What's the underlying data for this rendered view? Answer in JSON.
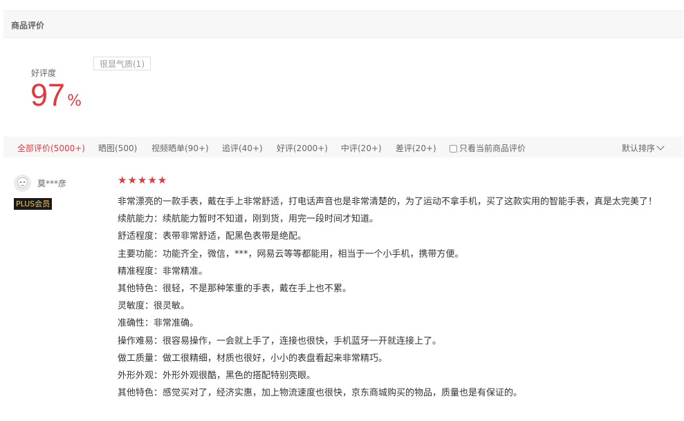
{
  "header": {
    "title": "商品评价"
  },
  "rating": {
    "label": "好评度",
    "value": "97",
    "unit": "%"
  },
  "tags": [
    {
      "label": "很显气质(1)"
    }
  ],
  "filters": [
    {
      "label": "全部评价(5000+)",
      "active": true
    },
    {
      "label": "晒图(500)"
    },
    {
      "label": "视频晒单(90+)"
    },
    {
      "label": "追评(40+)"
    },
    {
      "label": "好评(2000+)"
    },
    {
      "label": "中评(20+)"
    },
    {
      "label": "差评(20+)"
    }
  ],
  "only_current": {
    "label": "只看当前商品评价",
    "checked": false
  },
  "sort": {
    "label": "默认排序"
  },
  "review": {
    "user": "莫***彦",
    "badge": "PLUS会员",
    "stars": 5,
    "stars_text": "★★★★★",
    "lines": [
      "非常漂亮的一款手表，戴在手上非常舒适，打电话声音也是非常清楚的，为了运动不拿手机，买了这款实用的智能手表，真是太完美了！",
      "续航能力：续航能力暂时不知道，刚到货，用完一段时间才知道。",
      "舒适程度：表带非常舒适，配黑色表带是绝配。",
      "主要功能：功能齐全，微信，***，网易云等等都能用，相当于一个小手机，携带方便。",
      "精准程度：非常精准。",
      "其他特色：很轻，不是那种笨重的手表，戴在手上也不累。",
      "灵敏度：很灵敏。",
      "准确性：非常准确。",
      "操作难易：很容易操作，一会就上手了，连接也很快，手机蓝牙一开就连接上了。",
      "做工质量：做工很精细，材质也很好，小小的表盘看起来非常精巧。",
      "外形外观：外形外观很酷，黑色的搭配特别亮眼。",
      "其他特色：感觉买对了，经济实惠，加上物流速度也很快，京东商城购买的物品，质量也是有保证的。"
    ]
  },
  "colors": {
    "accent": "#e4393c",
    "badge_bg": "#1a1a1a",
    "badge_text": "#f0c75a"
  }
}
